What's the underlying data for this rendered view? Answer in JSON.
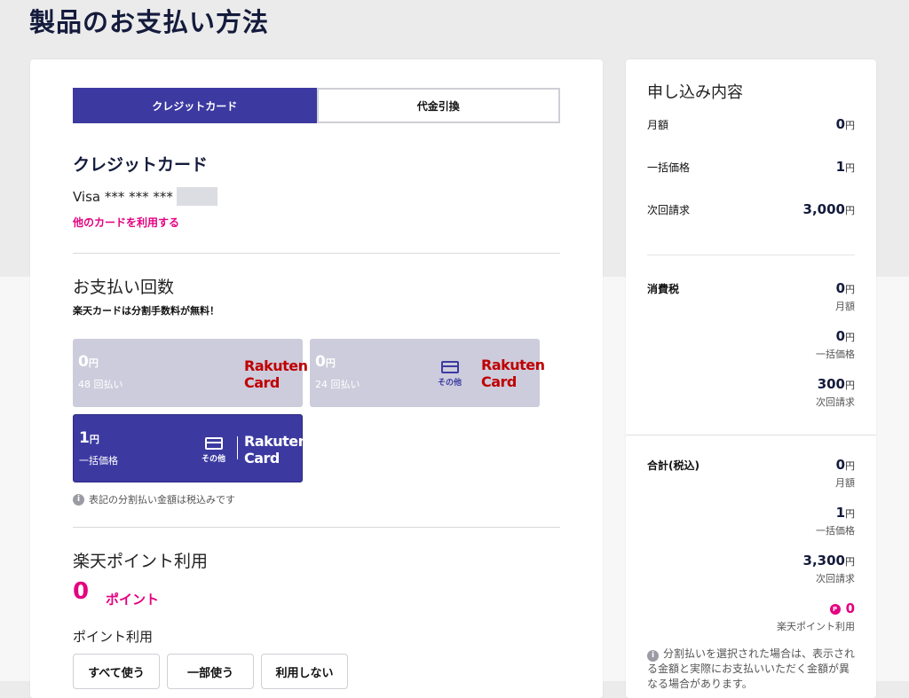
{
  "page": {
    "title": "製品のお支払い方法"
  },
  "tabs": [
    {
      "label": "クレジットカード",
      "active": true
    },
    {
      "label": "代金引換",
      "active": false
    }
  ],
  "credit": {
    "heading": "クレジットカード",
    "card_number": "Visa *** *** ***",
    "change_link": "他のカードを利用する"
  },
  "installments": {
    "heading": "お支払い回数",
    "note": "楽天カードは分割手数料が無料！",
    "plans": [
      {
        "amount": "0",
        "unit": "円",
        "label": "48 回払い",
        "logo_top": "Rakuten",
        "logo_bottom": "Card",
        "other_label": "",
        "selected": false
      },
      {
        "amount": "0",
        "unit": "円",
        "label": "24 回払い",
        "logo_top": "Rakuten",
        "logo_bottom": "Card",
        "other_label": "その他",
        "selected": false
      },
      {
        "amount": "1",
        "unit": "円",
        "label": "一括価格",
        "logo_top": "Rakuten",
        "logo_bottom": "Card",
        "other_label": "その他",
        "selected": true
      }
    ],
    "info_icon": "i",
    "info": "表記の分割払い金額は税込みです"
  },
  "points": {
    "heading": "楽天ポイント利用",
    "value": "0",
    "unit": "ポイント",
    "use_label": "ポイント利用",
    "options": [
      "すべて使う",
      "一部使う",
      "利用しない"
    ]
  },
  "summary": {
    "title": "申し込み内容",
    "rows": [
      {
        "label": "月額",
        "value": "0",
        "unit": "円"
      },
      {
        "label": "一括価格",
        "value": "1",
        "unit": "円"
      },
      {
        "label": "次回請求",
        "value": "3,000",
        "unit": "円"
      }
    ],
    "tax": {
      "label": "消費税",
      "items": [
        {
          "value": "0",
          "unit": "円",
          "caption": "月額"
        },
        {
          "value": "0",
          "unit": "円",
          "caption": "一括価格"
        },
        {
          "value": "300",
          "unit": "円",
          "caption": "次回請求"
        }
      ]
    },
    "total": {
      "label": "合計(税込)",
      "items": [
        {
          "value": "0",
          "unit": "円",
          "caption": "月額"
        },
        {
          "value": "1",
          "unit": "円",
          "caption": "一括価格"
        },
        {
          "value": "3,300",
          "unit": "円",
          "caption": "次回請求"
        }
      ],
      "points_icon": "P",
      "points_value": "0",
      "points_caption": "楽天ポイント利用"
    },
    "note_icon": "i",
    "note": "分割払いを選択された場合は、表示される金額と実際にお支払いいただく金額が異なる場合があります。"
  },
  "colors": {
    "primary": "#3c3aa1",
    "accent": "#e4007f",
    "rakuten_red": "#bf0000",
    "plan_unselected": "#cdccdc"
  }
}
